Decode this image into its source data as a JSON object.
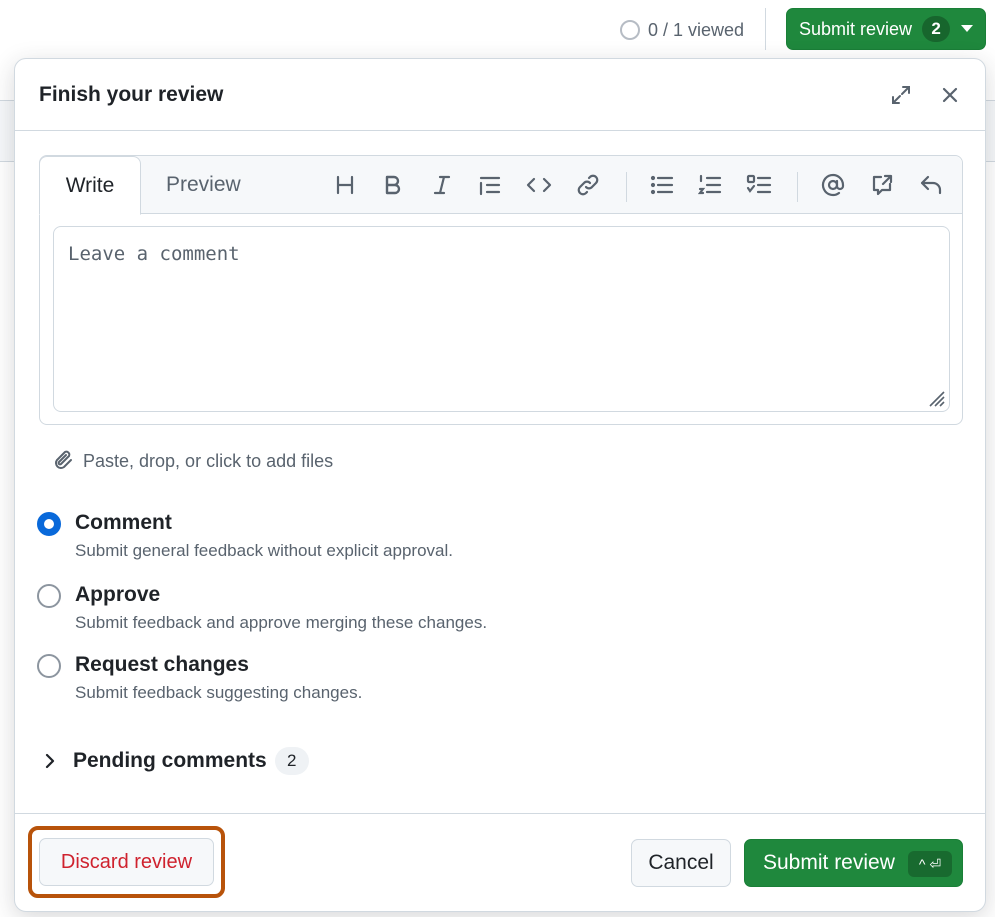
{
  "header": {
    "viewed_text": "0 / 1 viewed",
    "submit_label": "Submit review",
    "submit_count": "2"
  },
  "dialog": {
    "title": "Finish your review",
    "tabs": {
      "write": "Write",
      "preview": "Preview"
    },
    "toolbar_icons": [
      "heading-icon",
      "bold-icon",
      "italic-icon",
      "quote-icon",
      "code-icon",
      "link-icon",
      "unordered-list-icon",
      "ordered-list-icon",
      "task-list-icon",
      "mention-icon",
      "cross-reference-icon",
      "reply-icon"
    ],
    "comment_placeholder": "Leave a comment",
    "attach_text": "Paste, drop, or click to add files",
    "options": [
      {
        "label": "Comment",
        "desc": "Submit general feedback without explicit approval.",
        "selected": true
      },
      {
        "label": "Approve",
        "desc": "Submit feedback and approve merging these changes.",
        "selected": false
      },
      {
        "label": "Request changes",
        "desc": "Submit feedback suggesting changes.",
        "selected": false
      }
    ],
    "pending": {
      "label": "Pending comments",
      "count": "2"
    },
    "footer": {
      "discard_label": "Discard review",
      "cancel_label": "Cancel",
      "submit_label": "Submit review",
      "shortcut": "^ ⏎"
    }
  },
  "colors": {
    "primary_green": "#1f883d",
    "danger_red": "#cf222e",
    "selected_blue": "#0969da",
    "highlight_orange": "#b8530a"
  }
}
